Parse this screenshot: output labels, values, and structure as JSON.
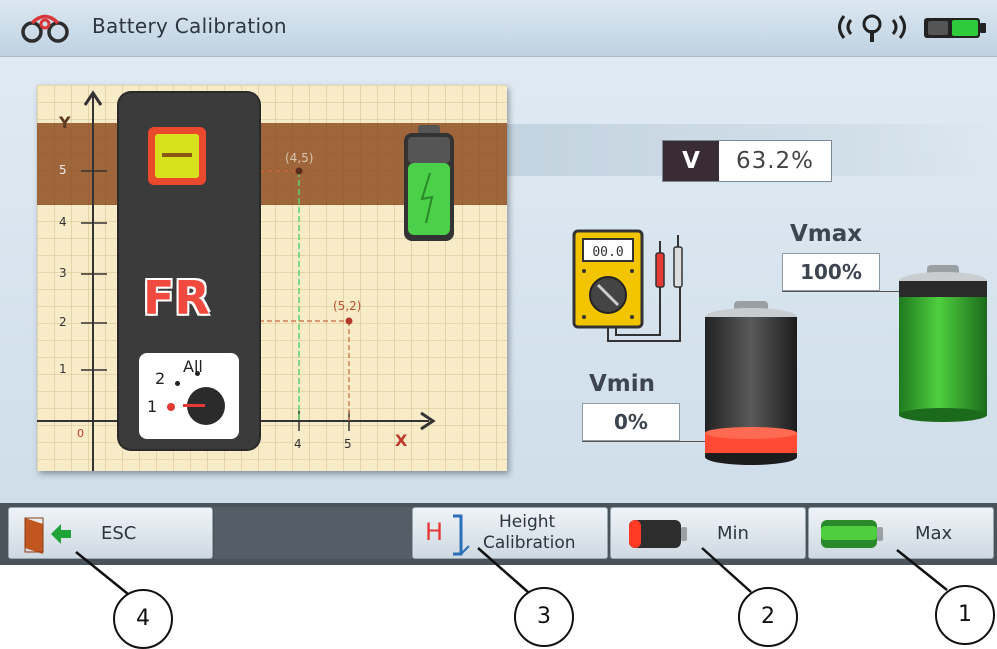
{
  "title": "Battery Calibration",
  "header_icons": [
    "logo-rings-icon",
    "wireless-signal-icon",
    "battery-status-icon"
  ],
  "graph": {
    "y_axis_label": "Y",
    "x_axis_label": "X",
    "origin_label": "0",
    "y_ticks": [
      "1",
      "2",
      "3",
      "4",
      "5"
    ],
    "x_ticks": [
      "4",
      "5"
    ],
    "points": [
      {
        "label": "(4,5)",
        "x": 4,
        "y": 5
      },
      {
        "label": "(5,2)",
        "x": 5,
        "y": 2
      }
    ]
  },
  "panel": {
    "display_code": "FR",
    "switch_positions": [
      "1",
      "2",
      "All"
    ]
  },
  "voltage": {
    "label": "V",
    "value": "63.2%"
  },
  "vmin": {
    "label": "Vmin",
    "value": "0%"
  },
  "vmax": {
    "label": "Vmax",
    "value": "100%"
  },
  "bottom_bar": {
    "esc_label": "ESC",
    "height_icon_letter": "H",
    "height_label_line1": "Height",
    "height_label_line2": "Calibration",
    "min_label": "Min",
    "max_label": "Max"
  },
  "callouts": [
    "1",
    "2",
    "3",
    "4"
  ],
  "colors": {
    "accent_red": "#e53935",
    "battery_green": "#37a32c",
    "title_bar": "#c9d9e6"
  }
}
